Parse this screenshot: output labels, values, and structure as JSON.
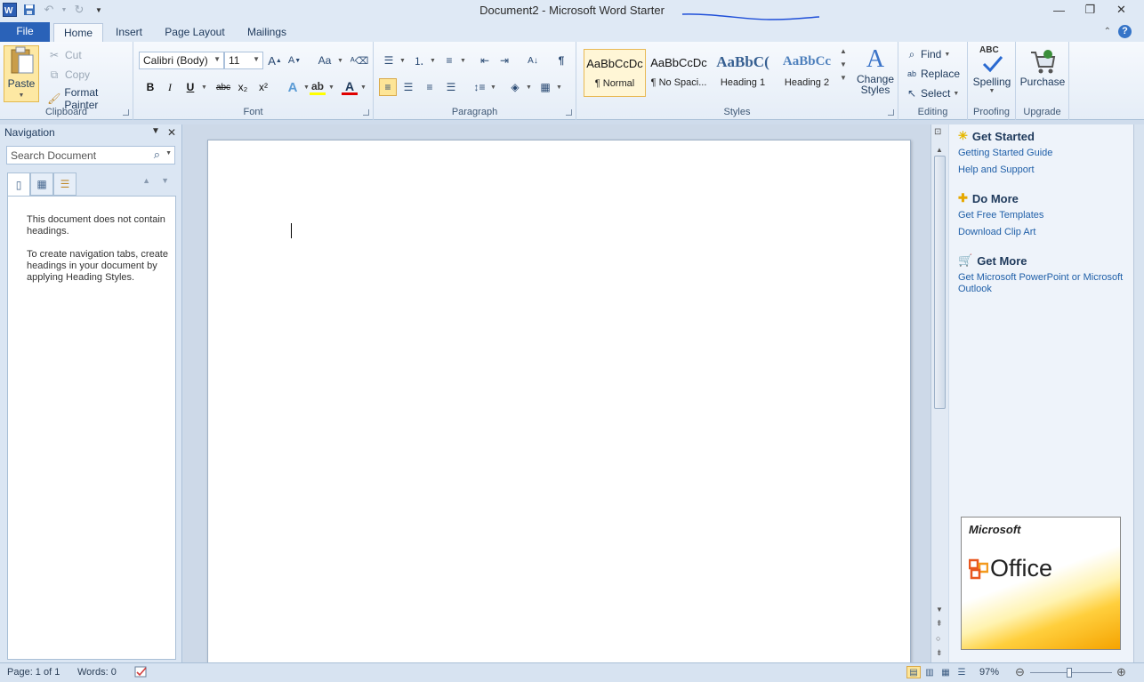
{
  "window": {
    "title": "Document2 - Microsoft Word Starter",
    "pen_color": "#1f4fd8"
  },
  "tabs": [
    "File",
    "Home",
    "Insert",
    "Page Layout",
    "Mailings"
  ],
  "ribbon": {
    "clipboard": {
      "label": "Clipboard",
      "paste": "Paste",
      "cut": "Cut",
      "copy": "Copy",
      "format_painter": "Format Painter"
    },
    "font": {
      "label": "Font",
      "font_name": "Calibri (Body)",
      "font_size": "11",
      "bold": "B",
      "italic": "I",
      "underline": "U",
      "strike": "abc",
      "subscript": "x₂",
      "superscript": "x²",
      "case": "Aa"
    },
    "paragraph": {
      "label": "Paragraph"
    },
    "styles": {
      "label": "Styles",
      "items": [
        {
          "preview": "AaBbCcDc",
          "name": "¶ Normal"
        },
        {
          "preview": "AaBbCcDc",
          "name": "¶ No Spaci..."
        },
        {
          "preview": "AaBbC(",
          "name": "Heading 1"
        },
        {
          "preview": "AaBbCc",
          "name": "Heading 2"
        }
      ],
      "change_styles": "Change Styles"
    },
    "editing": {
      "label": "Editing",
      "find": "Find",
      "replace": "Replace",
      "select": "Select"
    },
    "proofing": {
      "label": "Proofing",
      "spelling": "Spelling",
      "abc": "ABC"
    },
    "upgrade": {
      "label": "Upgrade",
      "purchase": "Purchase"
    }
  },
  "navigation": {
    "title": "Navigation",
    "search_placeholder": "Search Document",
    "message1": "This document does not contain headings.",
    "message2": "To create navigation tabs, create headings in your document by applying Heading Styles."
  },
  "taskpane": {
    "get_started": {
      "title": "Get Started",
      "links": [
        "Getting Started Guide",
        "Help and Support"
      ]
    },
    "do_more": {
      "title": "Do More",
      "links": [
        "Get Free Templates",
        "Download Clip Art"
      ]
    },
    "get_more": {
      "title": "Get More",
      "links": [
        "Get Microsoft PowerPoint or Microsoft Outlook"
      ]
    },
    "ad": {
      "brand": "Microsoft",
      "product": "Office"
    }
  },
  "statusbar": {
    "page": "Page: 1 of 1",
    "words": "Words: 0",
    "zoom": "97%"
  }
}
